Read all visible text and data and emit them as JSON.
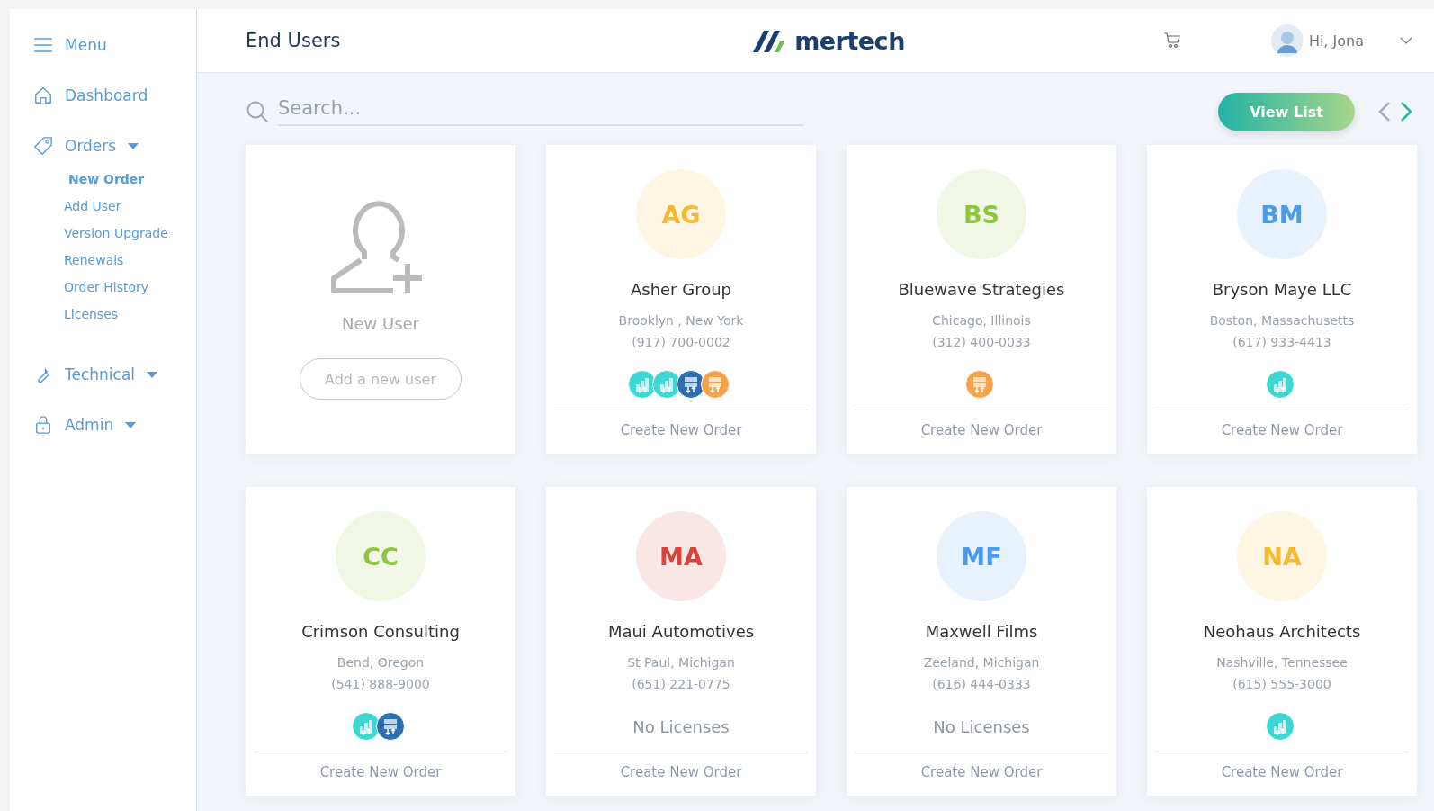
{
  "sidebar": {
    "menu_label": "Menu",
    "items": [
      {
        "kind": "home",
        "label": "Dashboard",
        "expandable": false
      },
      {
        "kind": "tag",
        "label": "Orders",
        "expandable": true,
        "children": [
          {
            "label": "New Order",
            "selected": true
          },
          {
            "label": "Add User",
            "selected": false
          },
          {
            "label": "Version Upgrade",
            "selected": false
          },
          {
            "label": "Renewals",
            "selected": false
          },
          {
            "label": "Order History",
            "selected": false
          },
          {
            "label": "Licenses",
            "selected": false
          }
        ]
      },
      {
        "kind": "wrench",
        "label": "Technical",
        "expandable": true
      },
      {
        "kind": "lock",
        "label": "Admin",
        "expandable": true
      }
    ]
  },
  "header": {
    "title": "End Users",
    "logo": "mertech",
    "greeting": "Hi, Jona"
  },
  "search": {
    "placeholder": "Search..."
  },
  "view_button": "View List",
  "new_user_card": {
    "title": "New User",
    "button": "Add a new user"
  },
  "cards": [
    {
      "initials": "AG",
      "color": "#f5b82e",
      "name": "Asher Group",
      "location": "Brooklyn , New York",
      "phone": "(917) 700-0002",
      "licenses": [
        {
          "kind": "analytics"
        },
        {
          "kind": "analytics"
        },
        {
          "kind": "server-blue"
        },
        {
          "kind": "server-orange"
        }
      ],
      "action": "Create New Order"
    },
    {
      "initials": "BS",
      "color": "#8cc63f",
      "name": "Bluewave Strategies",
      "location": "Chicago, Illinois",
      "phone": "(312) 400-0033",
      "licenses": [
        {
          "kind": "server-orange"
        }
      ],
      "action": "Create New Order"
    },
    {
      "initials": "BM",
      "color": "#4a9be8",
      "name": "Bryson Maye LLC",
      "location": "Boston, Massachusetts",
      "phone": "(617) 933-4413",
      "licenses": [
        {
          "kind": "analytics"
        }
      ],
      "action": "Create New Order"
    },
    {
      "initials": "CC",
      "color": "#8cc63f",
      "name": "Crimson Consulting",
      "location": "Bend, Oregon",
      "phone": "(541) 888-9000",
      "licenses": [
        {
          "kind": "analytics"
        },
        {
          "kind": "server-blue"
        }
      ],
      "action": "Create New Order"
    },
    {
      "initials": "MA",
      "color": "#d9433a",
      "name": "Maui Automotives",
      "location": "St Paul, Michigan",
      "phone": "(651) 221-0775",
      "empty_text": "No Licenses",
      "action": "Create New Order"
    },
    {
      "initials": "MF",
      "color": "#4a9be8",
      "name": "Maxwell Films",
      "location": "Zeeland, Michigan",
      "phone": "(616) 444-0333",
      "empty_text": "No Licenses",
      "action": "Create New Order"
    },
    {
      "initials": "NA",
      "color": "#f5b82e",
      "name": "Neohaus Architects",
      "location": "Nashville, Tennessee",
      "phone": "(615) 555-3000",
      "licenses": [
        {
          "kind": "analytics"
        }
      ],
      "action": "Create New Order"
    }
  ]
}
